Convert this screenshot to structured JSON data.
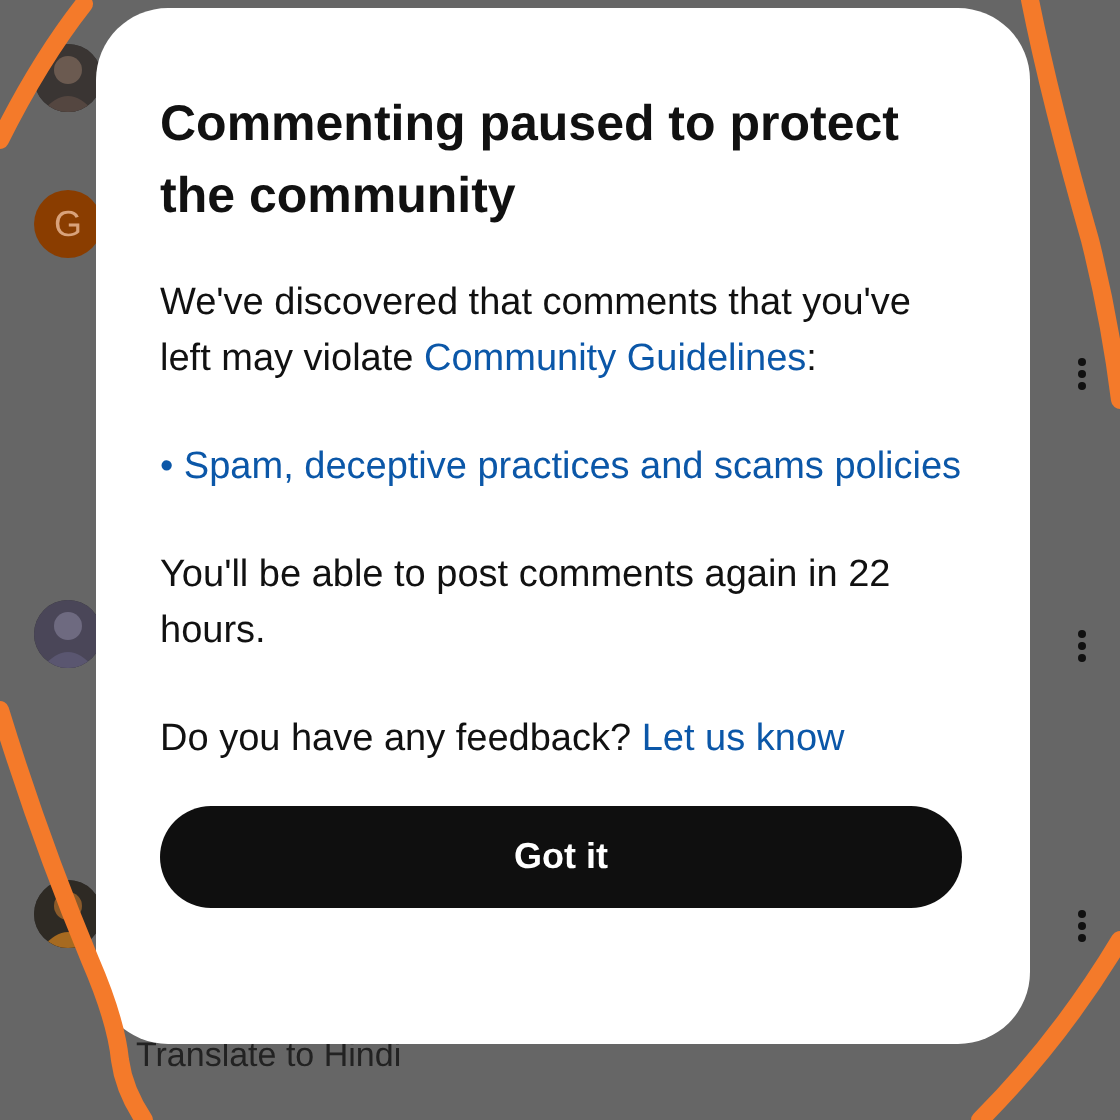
{
  "background": {
    "comments": [
      {
        "avatar": {
          "kind": "picture"
        }
      },
      {
        "avatar": {
          "kind": "letter",
          "letter": "G",
          "color": "#8a3d00"
        }
      },
      {
        "avatar": {
          "kind": "picture"
        }
      },
      {
        "avatar": {
          "kind": "picture"
        }
      }
    ],
    "translate_link": "Translate to Hindi"
  },
  "dialog": {
    "title": "Commenting paused to protect the community",
    "intro": "We've discovered that comments that you've left may violate ",
    "intro_link": "Community Guidelines",
    "intro_end": ":",
    "policy_link": "• Spam, deceptive practices and scams policies",
    "notice": "You'll be able to post comments again in 22 hours.",
    "feedback": "Do you have any feedback? ",
    "feedback_link": "Let us know",
    "button": "Got it"
  }
}
